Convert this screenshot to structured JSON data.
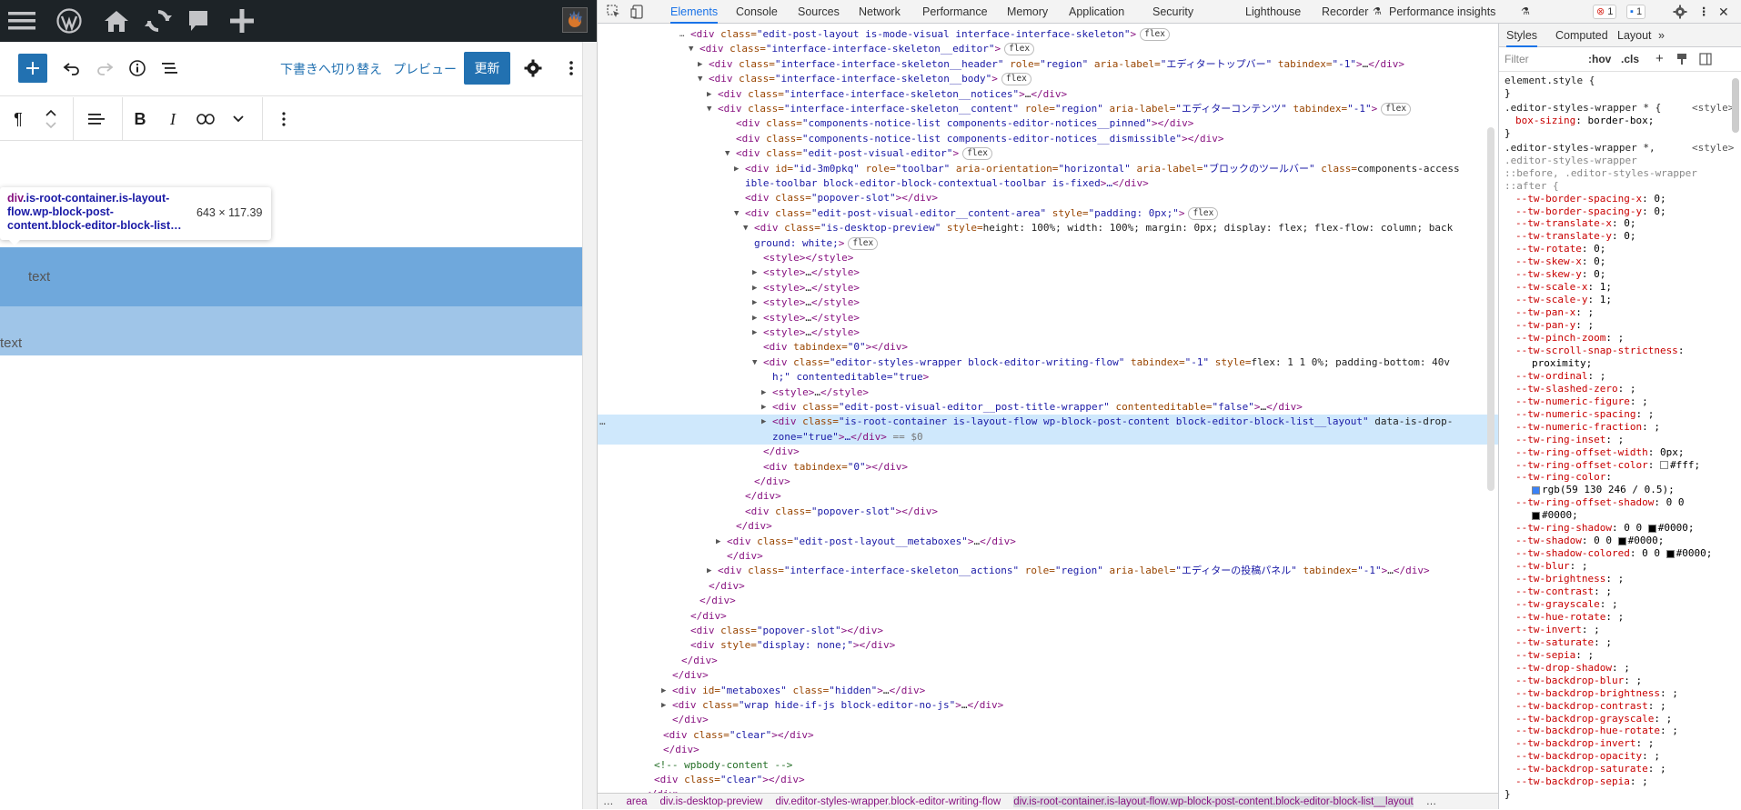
{
  "editor": {
    "switch_draft": "下書きへ切り替え",
    "preview": "プレビュー",
    "update": "更新",
    "tooltip_selector_tag": "div",
    "tooltip_selector_rest": ".is-root-container.is-layout-flow.wp-block-post-content.block-editor-block-list…",
    "tooltip_dims": "643 × 117.39",
    "block1_text": "text",
    "block2_text": "text"
  },
  "devtools": {
    "tabs": [
      "Elements",
      "Console",
      "Sources",
      "Network",
      "Performance",
      "Memory",
      "Application",
      "Security",
      "Lighthouse",
      "Recorder",
      "Performance insights"
    ],
    "error_count": "1",
    "message_count": "1",
    "styles_tabs": [
      "Styles",
      "Computed",
      "Layout"
    ],
    "filter_placeholder": "Filter",
    "hov": ":hov",
    "cls": ".cls",
    "breadcrumbs": [
      "…",
      "area",
      "div.is-desktop-preview",
      "div.editor-styles-wrapper.block-editor-writing-flow",
      "div.is-root-container.is-layout-flow.wp-block-post-content.block-editor-block-list__layout",
      "…"
    ]
  },
  "dom_lines": [
    {
      "i": "…",
      "t": "<div class=\"edit-post-layout is-mode-visual interface-interface-skeleton\">",
      "b": "flex"
    },
    {
      "i": "▼",
      "t": "<div class=\"interface-interface-skeleton__editor\">",
      "b": "flex"
    },
    {
      "i": "▶",
      "t": "<div class=\"interface-interface-skeleton__header\" role=\"region\" aria-label=\"エディタートップバー\" tabindex=\"-1\">…</div>",
      "b": ""
    },
    {
      "i": "▼",
      "t": "<div class=\"interface-interface-skeleton__body\">",
      "b": "flex"
    },
    {
      "i": "▶",
      "t": "<div class=\"interface-interface-skeleton__notices\">…</div>",
      "b": ""
    },
    {
      "i": "▼",
      "t": "<div class=\"interface-interface-skeleton__content\" role=\"region\" aria-label=\"エディターコンテンツ\" tabindex=\"-1\">",
      "b": "flex"
    },
    {
      "i": "",
      "t": "<div class=\"components-notice-list components-editor-notices__pinned\"></div>",
      "b": ""
    },
    {
      "i": "",
      "t": "<div class=\"components-notice-list components-editor-notices__dismissible\"></div>",
      "b": ""
    },
    {
      "i": "▼",
      "t": "<div class=\"edit-post-visual-editor\">",
      "b": "flex"
    },
    {
      "i": "▶",
      "t": "<div id=\"id-3m0pkq\" role=\"toolbar\" aria-orientation=\"horizontal\" aria-label=\"ブロックのツールバー\" class=\"components-access",
      "b": ""
    },
    {
      "i": "",
      "t": "ible-toolbar block-editor-block-contextual-toolbar is-fixed\">…</div>",
      "b": ""
    },
    {
      "i": "",
      "t": "<div class=\"popover-slot\"></div>",
      "b": ""
    },
    {
      "i": "▼",
      "t": "<div class=\"edit-post-visual-editor__content-area\" style=\"padding: 0px;\">",
      "b": "flex"
    },
    {
      "i": "▼",
      "t": "<div class=\"is-desktop-preview\" style=\"height: 100%; width: 100%; margin: 0px; display: flex; flex-flow: column; back",
      "b": ""
    },
    {
      "i": "",
      "t": "ground: white;\">",
      "b": "flex"
    },
    {
      "i": "",
      "t": "<style></style>",
      "b": ""
    },
    {
      "i": "▶",
      "t": "<style>…</style>",
      "b": ""
    },
    {
      "i": "▶",
      "t": "<style>…</style>",
      "b": ""
    },
    {
      "i": "▶",
      "t": "<style>…</style>",
      "b": ""
    },
    {
      "i": "▶",
      "t": "<style>…</style>",
      "b": ""
    },
    {
      "i": "▶",
      "t": "<style>…</style>",
      "b": ""
    },
    {
      "i": "",
      "t": "<div tabindex=\"0\"></div>",
      "b": ""
    },
    {
      "i": "▼",
      "t": "<div class=\"editor-styles-wrapper block-editor-writing-flow\" tabindex=\"-1\" style=\"flex: 1 1 0%; padding-bottom: 40v",
      "b": ""
    },
    {
      "i": "",
      "t": "h;\" contenteditable=\"true\">",
      "b": ""
    },
    {
      "i": "▶",
      "t": "<style>…</style>",
      "b": ""
    },
    {
      "i": "▶",
      "t": "<div class=\"edit-post-visual-editor__post-title-wrapper\" contenteditable=\"false\">…</div>",
      "b": ""
    },
    {
      "i": "▶",
      "t": "<div class=\"is-root-container is-layout-flow wp-block-post-content block-editor-block-list__layout\" data-is-drop-",
      "b": ""
    },
    {
      "i": "",
      "t": "zone=\"true\">…</div> == $0",
      "b": ""
    },
    {
      "i": "",
      "t": "</div>",
      "b": ""
    },
    {
      "i": "",
      "t": "<div tabindex=\"0\"></div>",
      "b": ""
    },
    {
      "i": "",
      "t": "</div>",
      "b": ""
    },
    {
      "i": "",
      "t": "</div>",
      "b": ""
    },
    {
      "i": "",
      "t": "<div class=\"popover-slot\"></div>",
      "b": ""
    },
    {
      "i": "",
      "t": "</div>",
      "b": ""
    },
    {
      "i": "▶",
      "t": "<div class=\"edit-post-layout__metaboxes\">…</div>",
      "b": ""
    },
    {
      "i": "",
      "t": "</div>",
      "b": ""
    },
    {
      "i": "▶",
      "t": "<div class=\"interface-interface-skeleton__actions\" role=\"region\" aria-label=\"エディターの投稿パネル\" tabindex=\"-1\">…</div>",
      "b": ""
    },
    {
      "i": "",
      "t": "</div>",
      "b": ""
    },
    {
      "i": "",
      "t": "</div>",
      "b": ""
    },
    {
      "i": "",
      "t": "</div>",
      "b": ""
    },
    {
      "i": "",
      "t": "<div class=\"popover-slot\"></div>",
      "b": ""
    },
    {
      "i": "",
      "t": "<div style=\"display: none;\"></div>",
      "b": ""
    },
    {
      "i": "",
      "t": "</div>",
      "b": ""
    },
    {
      "i": "",
      "t": "</div>",
      "b": ""
    },
    {
      "i": "▶",
      "t": "<div id=\"metaboxes\" class=\"hidden\">…</div>",
      "b": ""
    },
    {
      "i": "▶",
      "t": "<div class=\"wrap hide-if-js block-editor-no-js\">…</div>",
      "b": ""
    },
    {
      "i": "",
      "t": "</div>",
      "b": ""
    },
    {
      "i": "",
      "t": "<div class=\"clear\"></div>",
      "b": ""
    },
    {
      "i": "",
      "t": "</div>",
      "b": ""
    },
    {
      "i": "",
      "t": "<!-- wpbody-content -->",
      "b": ""
    },
    {
      "i": "",
      "t": "<div class=\"clear\"></div>",
      "b": ""
    },
    {
      "i": "",
      "t": "</div>",
      "b": ""
    }
  ],
  "style_lines": [
    {
      "k": "sel",
      "t": "element.style {"
    },
    {
      "k": "plain",
      "t": "}"
    },
    {
      "k": "sel",
      "t": ".editor-styles-wrapper * {",
      "s": "<style>"
    },
    {
      "k": "prop",
      "n": "box-sizing",
      "v": "border-box;"
    },
    {
      "k": "plain",
      "t": "}"
    },
    {
      "k": "sel",
      "t": ".editor-styles-wrapper *,",
      "s": "<style>"
    },
    {
      "k": "dim",
      "t": ".editor-styles-wrapper"
    },
    {
      "k": "dim",
      "t": "::before, .editor-styles-wrapper"
    },
    {
      "k": "dim",
      "t": "::after {"
    },
    {
      "k": "prop",
      "n": "--tw-border-spacing-x",
      "v": "0;"
    },
    {
      "k": "prop",
      "n": "--tw-border-spacing-y",
      "v": "0;"
    },
    {
      "k": "prop",
      "n": "--tw-translate-x",
      "v": "0;"
    },
    {
      "k": "prop",
      "n": "--tw-translate-y",
      "v": "0;"
    },
    {
      "k": "prop",
      "n": "--tw-rotate",
      "v": "0;"
    },
    {
      "k": "prop",
      "n": "--tw-skew-x",
      "v": "0;"
    },
    {
      "k": "prop",
      "n": "--tw-skew-y",
      "v": "0;"
    },
    {
      "k": "prop",
      "n": "--tw-scale-x",
      "v": "1;"
    },
    {
      "k": "prop",
      "n": "--tw-scale-y",
      "v": "1;"
    },
    {
      "k": "prop",
      "n": "--tw-pan-x",
      "v": ";"
    },
    {
      "k": "prop",
      "n": "--tw-pan-y",
      "v": ";"
    },
    {
      "k": "prop",
      "n": "--tw-pinch-zoom",
      "v": ";"
    },
    {
      "k": "prop",
      "n": "--tw-scroll-snap-strictness",
      "v": ""
    },
    {
      "k": "cont",
      "t": "proximity;"
    },
    {
      "k": "prop",
      "n": "--tw-ordinal",
      "v": ";"
    },
    {
      "k": "prop",
      "n": "--tw-slashed-zero",
      "v": ";"
    },
    {
      "k": "prop",
      "n": "--tw-numeric-figure",
      "v": ";"
    },
    {
      "k": "prop",
      "n": "--tw-numeric-spacing",
      "v": ";"
    },
    {
      "k": "prop",
      "n": "--tw-numeric-fraction",
      "v": ";"
    },
    {
      "k": "prop",
      "n": "--tw-ring-inset",
      "v": ";"
    },
    {
      "k": "prop",
      "n": "--tw-ring-offset-width",
      "v": "0px;"
    },
    {
      "k": "propsw",
      "n": "--tw-ring-offset-color",
      "v": "#fff;",
      "c": "#ffffff"
    },
    {
      "k": "prop",
      "n": "--tw-ring-color",
      "v": ""
    },
    {
      "k": "contsw",
      "t": "rgb(59 130 246 / 0.5);",
      "c": "#3b82f6"
    },
    {
      "k": "prop",
      "n": "--tw-ring-offset-shadow",
      "v": "0 0"
    },
    {
      "k": "contsw",
      "t": "#0000;",
      "c": "#000000"
    },
    {
      "k": "propsw2",
      "n": "--tw-ring-shadow",
      "v": "0 0 ",
      "v2": "#0000;",
      "c": "#000000"
    },
    {
      "k": "propsw2",
      "n": "--tw-shadow",
      "v": "0 0 ",
      "v2": "#0000;",
      "c": "#000000"
    },
    {
      "k": "propsw2",
      "n": "--tw-shadow-colored",
      "v": "0 0 ",
      "v2": "#0000;",
      "c": "#000000"
    },
    {
      "k": "prop",
      "n": "--tw-blur",
      "v": ";"
    },
    {
      "k": "prop",
      "n": "--tw-brightness",
      "v": ";"
    },
    {
      "k": "prop",
      "n": "--tw-contrast",
      "v": ";"
    },
    {
      "k": "prop",
      "n": "--tw-grayscale",
      "v": ";"
    },
    {
      "k": "prop",
      "n": "--tw-hue-rotate",
      "v": ";"
    },
    {
      "k": "prop",
      "n": "--tw-invert",
      "v": ";"
    },
    {
      "k": "prop",
      "n": "--tw-saturate",
      "v": ";"
    },
    {
      "k": "prop",
      "n": "--tw-sepia",
      "v": ";"
    },
    {
      "k": "prop",
      "n": "--tw-drop-shadow",
      "v": ";"
    },
    {
      "k": "prop",
      "n": "--tw-backdrop-blur",
      "v": ";"
    },
    {
      "k": "prop",
      "n": "--tw-backdrop-brightness",
      "v": ";"
    },
    {
      "k": "prop",
      "n": "--tw-backdrop-contrast",
      "v": ";"
    },
    {
      "k": "prop",
      "n": "--tw-backdrop-grayscale",
      "v": ";"
    },
    {
      "k": "prop",
      "n": "--tw-backdrop-hue-rotate",
      "v": ";"
    },
    {
      "k": "prop",
      "n": "--tw-backdrop-invert",
      "v": ";"
    },
    {
      "k": "prop",
      "n": "--tw-backdrop-opacity",
      "v": ";"
    },
    {
      "k": "prop",
      "n": "--tw-backdrop-saturate",
      "v": ";"
    },
    {
      "k": "prop",
      "n": "--tw-backdrop-sepia",
      "v": ";"
    },
    {
      "k": "plain",
      "t": "}"
    }
  ]
}
